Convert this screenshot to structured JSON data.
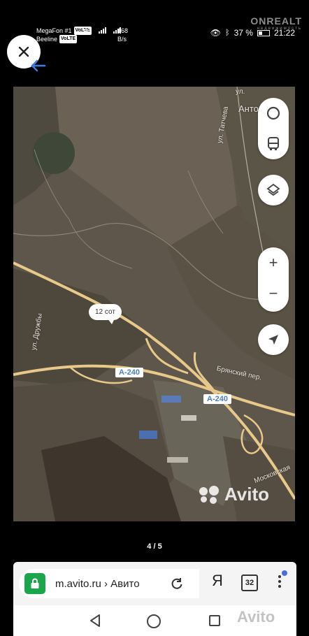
{
  "status_bar": {
    "carrier1": "MegaFon #1",
    "carrier2": "Beeline",
    "volte": "VoLTE",
    "network": "4G",
    "speed_value": "168",
    "speed_unit": "B/s",
    "battery": "37 %",
    "time": "21:22",
    "watermark": "ONREALT",
    "watermark_sub": "недвижимость"
  },
  "viewer": {
    "close_icon": "close-icon",
    "back_icon": "arrow-left-icon",
    "counter": "4 / 5"
  },
  "map": {
    "labels": {
      "street_tatchev": "ул. Татчева",
      "street_druzhby": "ул. Дружбы",
      "settlement": "Антоновка",
      "bryansky": "Брянский пер.",
      "moskovskaya": "Московская",
      "street_top": "ул."
    },
    "road_badge_1": "A-240",
    "road_badge_2": "A-240",
    "plot_label": "12 сот",
    "watermark": "Avito",
    "controls": {
      "traffic_icon": "traffic-circle-icon",
      "transit_icon": "bus-icon",
      "layers_icon": "layers-icon",
      "zoom_in": "+",
      "zoom_out": "−",
      "locate_icon": "location-arrow-icon"
    }
  },
  "browser": {
    "url": "m.avito.ru › Авито",
    "yandex": "Я",
    "tabs_count": "32",
    "secure_color": "#1ba64c"
  },
  "nav": {
    "watermark": "Avito"
  }
}
